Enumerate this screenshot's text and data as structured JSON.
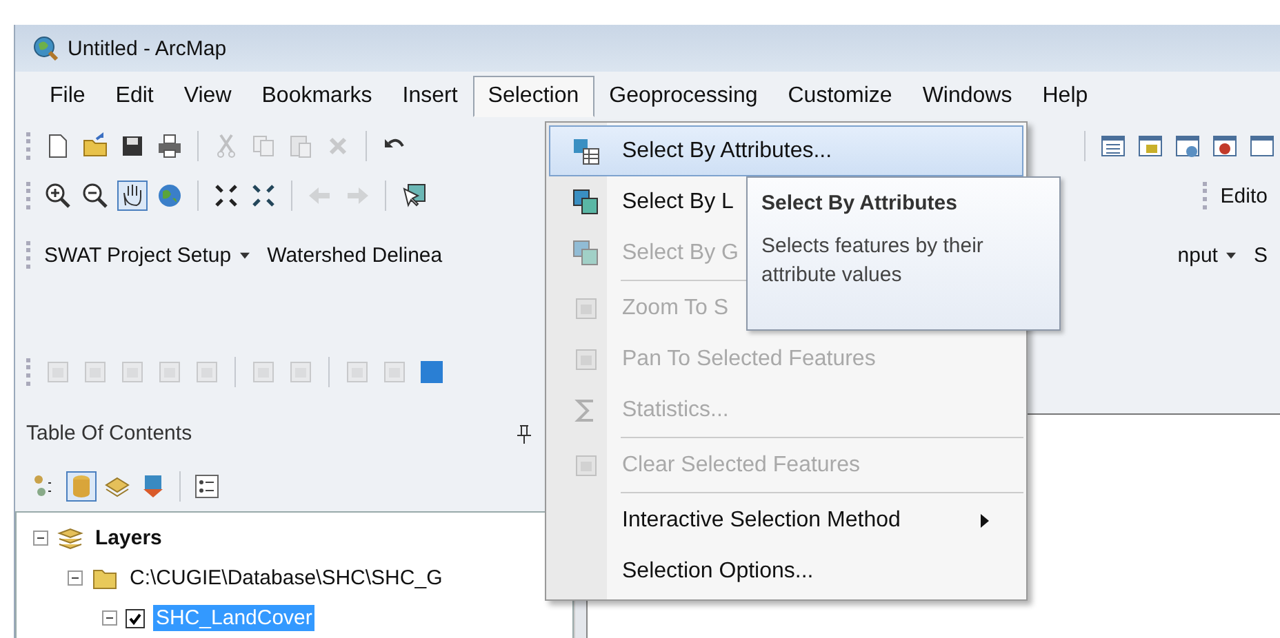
{
  "window": {
    "title": "Untitled - ArcMap"
  },
  "menu_bar": [
    {
      "label": "File",
      "selected": false
    },
    {
      "label": "Edit",
      "selected": false
    },
    {
      "label": "View",
      "selected": false
    },
    {
      "label": "Bookmarks",
      "selected": false
    },
    {
      "label": "Insert",
      "selected": false
    },
    {
      "label": "Selection",
      "selected": true
    },
    {
      "label": "Geoprocessing",
      "selected": false
    },
    {
      "label": "Customize",
      "selected": false
    },
    {
      "label": "Windows",
      "selected": false
    },
    {
      "label": "Help",
      "selected": false
    }
  ],
  "toolbar_right_label": "Edito",
  "extension_toolbar": {
    "left": [
      {
        "label": "SWAT Project Setup",
        "dropdown": true
      },
      {
        "label": "Watershed Delinea",
        "dropdown": false
      }
    ],
    "right": [
      {
        "label": "nput",
        "dropdown": true
      },
      {
        "label": "S",
        "dropdown": false
      }
    ]
  },
  "table_of_contents": {
    "title": "Table Of Contents",
    "tree": [
      {
        "label": "Layers",
        "kind": "frame",
        "expanded": true,
        "children": [
          {
            "label": "C:\\CUGIE\\Database\\SHC\\SHC_G",
            "kind": "folder",
            "expanded": true,
            "children": [
              {
                "label": "SHC_LandCover",
                "kind": "layer",
                "expanded": true,
                "checked": true,
                "selected": true
              }
            ]
          }
        ]
      }
    ]
  },
  "dropdown_menu": {
    "items": [
      {
        "label": "Select By Attributes...",
        "kind": "tool",
        "disabled": false,
        "selected": true
      },
      {
        "label": "Select By L",
        "kind": "tool",
        "disabled": false,
        "selected": false
      },
      {
        "label": "Select By G",
        "kind": "tool",
        "disabled": true,
        "selected": false
      },
      {
        "kind": "separator"
      },
      {
        "label": "Zoom To S",
        "kind": "tool",
        "disabled": true,
        "selected": false
      },
      {
        "label": "Pan To Selected Features",
        "kind": "tool",
        "disabled": true,
        "selected": false
      },
      {
        "label": "Statistics...",
        "kind": "tool",
        "disabled": true,
        "selected": false
      },
      {
        "kind": "separator"
      },
      {
        "label": "Clear Selected Features",
        "kind": "tool",
        "disabled": true,
        "selected": false
      },
      {
        "kind": "separator"
      },
      {
        "label": "Interactive Selection Method",
        "kind": "submenu",
        "disabled": false,
        "selected": false
      },
      {
        "label": "Selection Options...",
        "kind": "command",
        "disabled": false,
        "selected": false
      }
    ]
  },
  "tooltip": {
    "title": "Select By Attributes",
    "text": "Selects features by their attribute values"
  }
}
